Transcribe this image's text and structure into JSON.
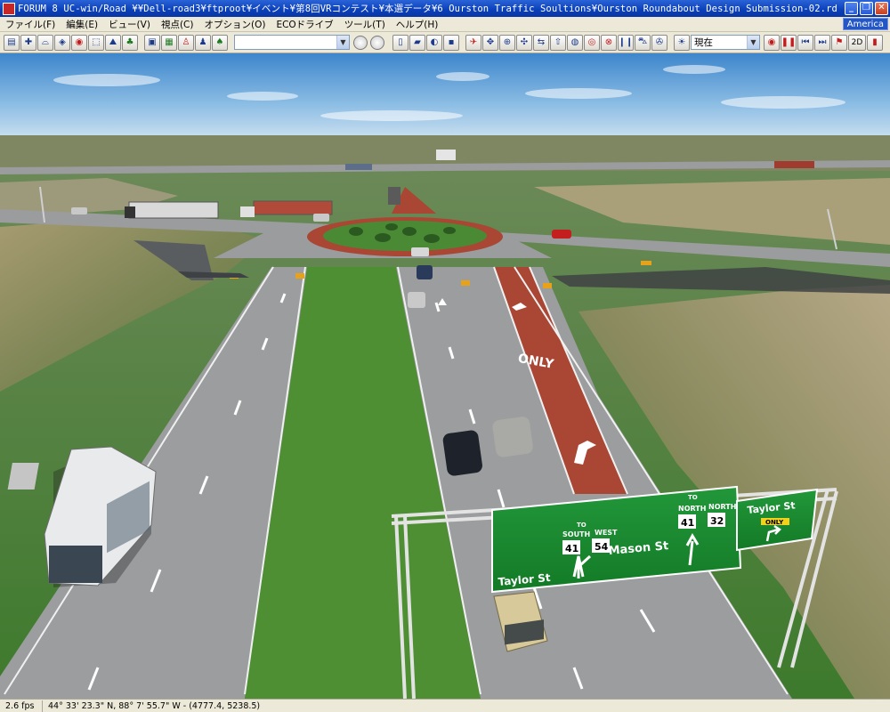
{
  "window": {
    "title": "FORUM 8    UC-win/Road     ¥¥Dell-road3¥ftproot¥イベント¥第8回VRコンテスト¥本選データ¥6 Ourston Traffic Soultions¥Ourston Roundabout Design Submission-02.rd",
    "minimize_label": "_",
    "maximize_label": "❐",
    "close_label": "✕"
  },
  "menu": {
    "items": [
      "ファイル(F)",
      "編集(E)",
      "ビュー(V)",
      "視点(C)",
      "オプション(O)",
      "ECOドライブ",
      "ツール(T)",
      "ヘルプ(H)"
    ],
    "region": "America"
  },
  "toolbar": {
    "view_combo_value": "",
    "time_combo_value": "現在",
    "mode_2d_label": "2D"
  },
  "signs": {
    "main_south_to": "TO",
    "main_south": "SOUTH",
    "main_west": "WEST",
    "main_route_41": "41",
    "main_route_54": "54",
    "main_taylor": "Taylor St",
    "main_mason": "Mason St",
    "main_north_to": "TO",
    "main_north": "NORTH",
    "main_north_2": "NORTH",
    "main_route_41b": "41",
    "main_route_32": "32",
    "side_taylor": "Taylor St",
    "side_only": "ONLY",
    "pavement_only": "ONLY"
  },
  "status": {
    "fps": "2.6 fps",
    "coords": "44° 33' 23.3\" N, 88° 7' 55.7\" W  -  (4777.4, 5238.5)"
  },
  "colors": {
    "sky_top": "#4a8fd0",
    "grass": "#4f8a3a",
    "asphalt": "#8d8f90",
    "median_red": "#b24a3a",
    "sign_green": "#1e8a2a",
    "titlebar": "#0a3fb8"
  }
}
